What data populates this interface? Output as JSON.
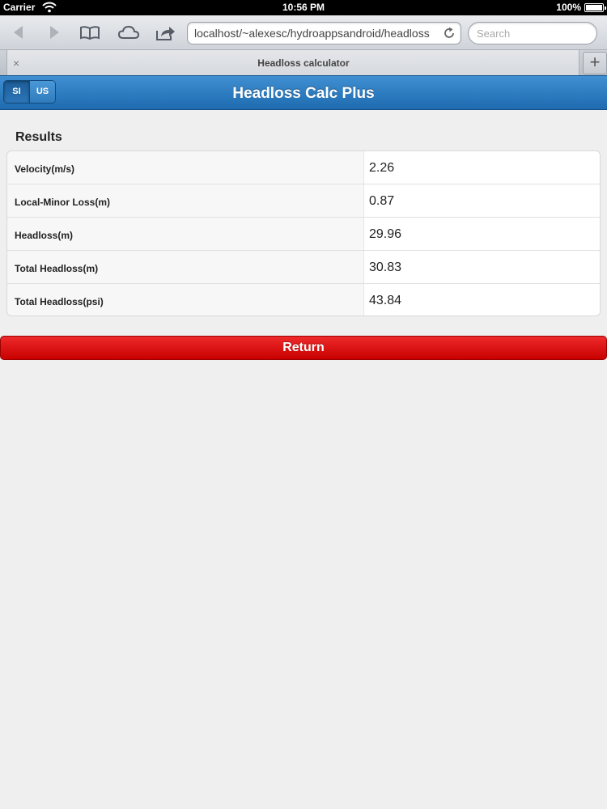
{
  "status_bar": {
    "carrier": "Carrier",
    "time": "10:56 PM",
    "battery": "100%"
  },
  "browser": {
    "url": "localhost/~alexesc/hydroappsandroid/headloss",
    "search_placeholder": "Search",
    "tab_title": "Headloss calculator",
    "tab_close": "×",
    "new_tab": "+"
  },
  "header": {
    "title": "Headloss Calc Plus",
    "units": [
      "SI",
      "US"
    ],
    "selected_unit": "SI",
    "accent_color": "#2a7cc0"
  },
  "results": {
    "heading": "Results",
    "rows": [
      {
        "label": "Velocity(m/s)",
        "value": "2.26"
      },
      {
        "label": "Local-Minor Loss(m)",
        "value": "0.87"
      },
      {
        "label": "Headloss(m)",
        "value": "29.96"
      },
      {
        "label": "Total Headloss(m)",
        "value": "30.83"
      },
      {
        "label": "Total Headloss(psi)",
        "value": "43.84"
      }
    ]
  },
  "actions": {
    "return_label": "Return",
    "return_color": "#dd0000"
  }
}
